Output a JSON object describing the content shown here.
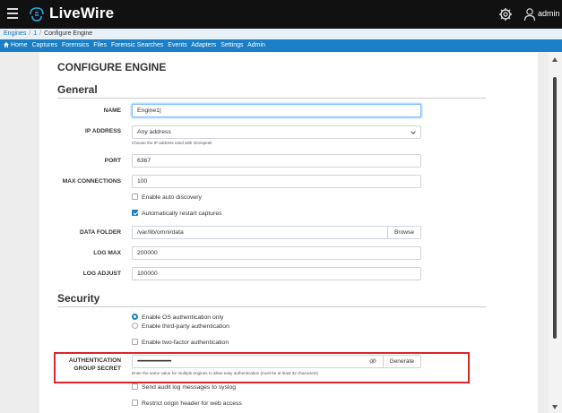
{
  "app": {
    "title": "LiveWire",
    "user": "admin"
  },
  "breadcrumb": {
    "items": [
      "Engines",
      "1",
      "Configure Engine"
    ],
    "separator": "/"
  },
  "nav": {
    "home_icon": "home-icon",
    "items": [
      "Home",
      "Captures",
      "Forensics",
      "Files",
      "Forensic Searches",
      "Events",
      "Adapters",
      "Settings",
      "Admin"
    ]
  },
  "page": {
    "title": "CONFIGURE ENGINE"
  },
  "general": {
    "title": "General",
    "name_label": "NAME",
    "name_value": "Engine1|",
    "ip_label": "IP ADDRESS",
    "ip_value": "Any address",
    "ip_help": "Choose the IP address used with Omnipeek",
    "port_label": "PORT",
    "port_value": "6367",
    "maxconn_label": "MAX CONNECTIONS",
    "maxconn_value": "100",
    "auto_discovery": "Enable auto discovery",
    "auto_restart": "Automatically restart captures",
    "datafolder_label": "DATA FOLDER",
    "datafolder_value": "/var/lib/omni/data",
    "browse": "Browse",
    "logmax_label": "LOG MAX",
    "logmax_value": "200000",
    "logadjust_label": "LOG ADJUST",
    "logadjust_value": "100000"
  },
  "security": {
    "title": "Security",
    "os_auth": "Enable OS authentication only",
    "third_party_auth": "Enable third-party authentication",
    "two_factor": "Enable two-factor authentication",
    "secret_label_1": "AUTHENTICATION",
    "secret_label_2": "GROUP SECRET",
    "secret_value": "••••••••••••••••••••••••••••••••••",
    "generate": "Generate",
    "secret_help": "Enter the same value for multiple engines to allow easy authentication (must be at least 32 characters)",
    "audit_syslog": "Send audit log messages to syslog",
    "restrict_origin": "Restrict origin header for web access"
  },
  "colors": {
    "accent": "#1a7fc6",
    "topbar": "#111111",
    "highlight": "#d9262a"
  }
}
